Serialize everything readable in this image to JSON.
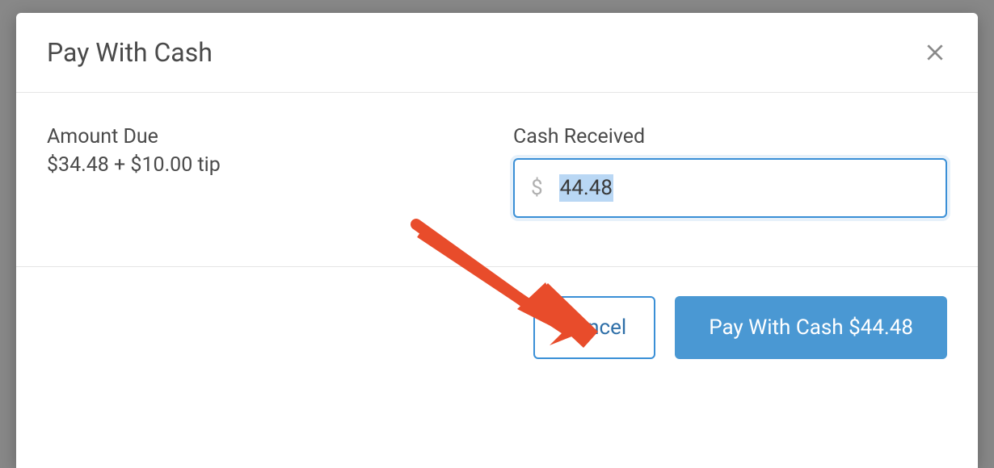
{
  "modal": {
    "title": "Pay With Cash",
    "amount_due_label": "Amount Due",
    "amount_due_value": "$34.48 + $10.00 tip",
    "cash_received_label": "Cash Received",
    "cash_received_value": "44.48",
    "currency_symbol": "$",
    "cancel_label": "Cancel",
    "pay_button_label": "Pay With Cash $44.48"
  },
  "colors": {
    "primary": "#4a98d3",
    "border_focus": "#3a8fd6",
    "text": "#4a4a4a",
    "muted": "#8a8a8a",
    "arrow": "#e84c2b"
  }
}
